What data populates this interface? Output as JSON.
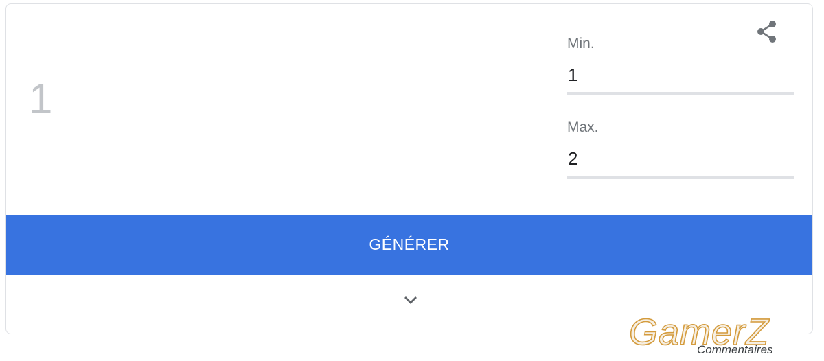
{
  "result": {
    "value": "1"
  },
  "min_field": {
    "label": "Min.",
    "value": "1"
  },
  "max_field": {
    "label": "Max.",
    "value": "2"
  },
  "generate_button": {
    "label": "GÉNÉRER"
  },
  "share": {
    "icon": "share-icon"
  },
  "expand": {
    "icon": "chevron-down-icon"
  },
  "watermark": {
    "text": "GamerZ"
  },
  "feedback": {
    "label": "Commentaires"
  },
  "colors": {
    "accent": "#3873e0",
    "result_text": "#c2c5c9",
    "label_text": "#70757a",
    "underline": "#dfe1e5",
    "watermark_fill": "#f6efe3",
    "watermark_stroke": "#d49b3c"
  }
}
